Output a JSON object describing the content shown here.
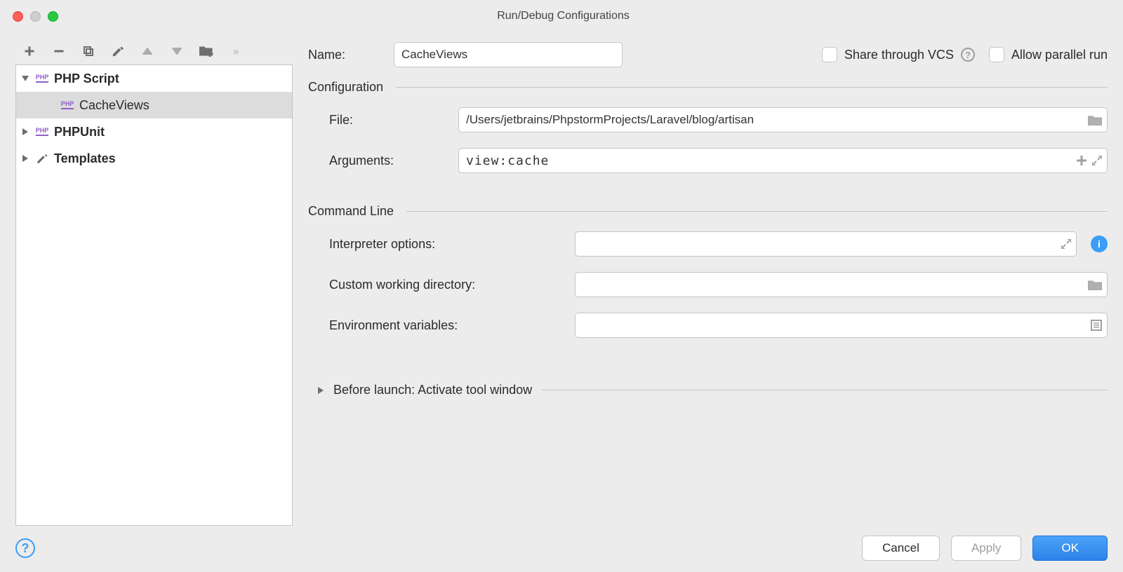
{
  "window": {
    "title": "Run/Debug Configurations"
  },
  "tree": {
    "items": [
      {
        "label": "PHP Script",
        "bold": true,
        "expanded": true,
        "icon": "php"
      },
      {
        "label": "CacheViews",
        "bold": false,
        "expanded": null,
        "icon": "php",
        "selected": true,
        "indent": true
      },
      {
        "label": "PHPUnit",
        "bold": true,
        "expanded": false,
        "icon": "php"
      },
      {
        "label": "Templates",
        "bold": true,
        "expanded": false,
        "icon": "wrench"
      }
    ]
  },
  "form": {
    "name_label": "Name:",
    "name_value": "CacheViews",
    "share_label": "Share through VCS",
    "allow_parallel_label": "Allow parallel run",
    "config_section": "Configuration",
    "file_label": "File:",
    "file_value": "/Users/jetbrains/PhpstormProjects/Laravel/blog/artisan",
    "arguments_label": "Arguments:",
    "arguments_value": "view:cache",
    "cmd_section": "Command Line",
    "interp_label": "Interpreter options:",
    "interp_value": "",
    "cwd_label": "Custom working directory:",
    "cwd_value": "",
    "env_label": "Environment variables:",
    "env_value": "",
    "before_launch": "Before launch: Activate tool window"
  },
  "buttons": {
    "cancel": "Cancel",
    "apply": "Apply",
    "ok": "OK"
  }
}
